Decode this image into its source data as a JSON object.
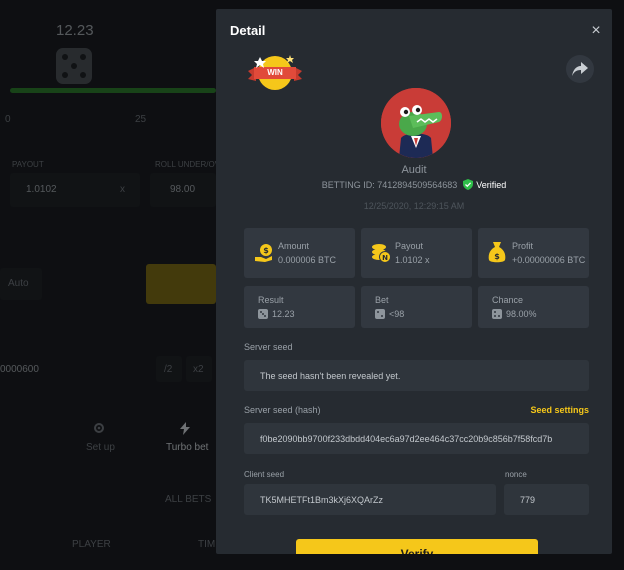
{
  "background": {
    "dice_value": "12.23",
    "scale_0": "0",
    "scale_25": "25",
    "payout_label": "PAYOUT",
    "payout_value": "1.0102",
    "payout_suffix": "x",
    "roll_label": "ROLL UNDER/OVER",
    "roll_value": "98.00",
    "auto_label": "Auto",
    "bet_amount": "0000600",
    "half_label": "/2",
    "double_label": "x2",
    "setup_label": "Set up",
    "turbo_label": "Turbo bet",
    "all_bets_label": "ALL BETS",
    "player_label": "PLAYER",
    "time_label": "TIM"
  },
  "modal": {
    "title": "Detail",
    "close_symbol": "×",
    "win_label": "WIN",
    "username": "Audit",
    "betting_id": "BETTING ID: 7412894509564683",
    "verified_label": "Verified",
    "timestamp": "12/25/2020, 12:29:15 AM",
    "stats": [
      {
        "label": "Amount",
        "value": "0.000006 BTC"
      },
      {
        "label": "Payout",
        "value": "1.0102 x"
      },
      {
        "label": "Profit",
        "value": "+0.00000006 BTC"
      },
      {
        "label": "Result",
        "value": "12.23"
      },
      {
        "label": "Bet",
        "value": "<98"
      },
      {
        "label": "Chance",
        "value": "98.00%"
      }
    ],
    "server_seed_label": "Server seed",
    "server_seed_value": "The seed hasn't been revealed yet.",
    "server_seed_hash_label": "Server seed (hash)",
    "seed_settings_label": "Seed settings",
    "server_seed_hash_value": "f0be2090bb9700f233dbdd404ec6a97d2ee464c37cc20b9c856b7f58fcd7b",
    "client_seed_label": "Client seed",
    "client_seed_value": "TK5MHETFt1Bm3kXj6XQArZz",
    "nonce_label": "nonce",
    "nonce_value": "779",
    "verify_label": "Verify"
  },
  "colors": {
    "accent": "#f5c71a",
    "verified": "#2fbf4a",
    "modal_bg": "#262b31",
    "card_bg": "#323840"
  }
}
